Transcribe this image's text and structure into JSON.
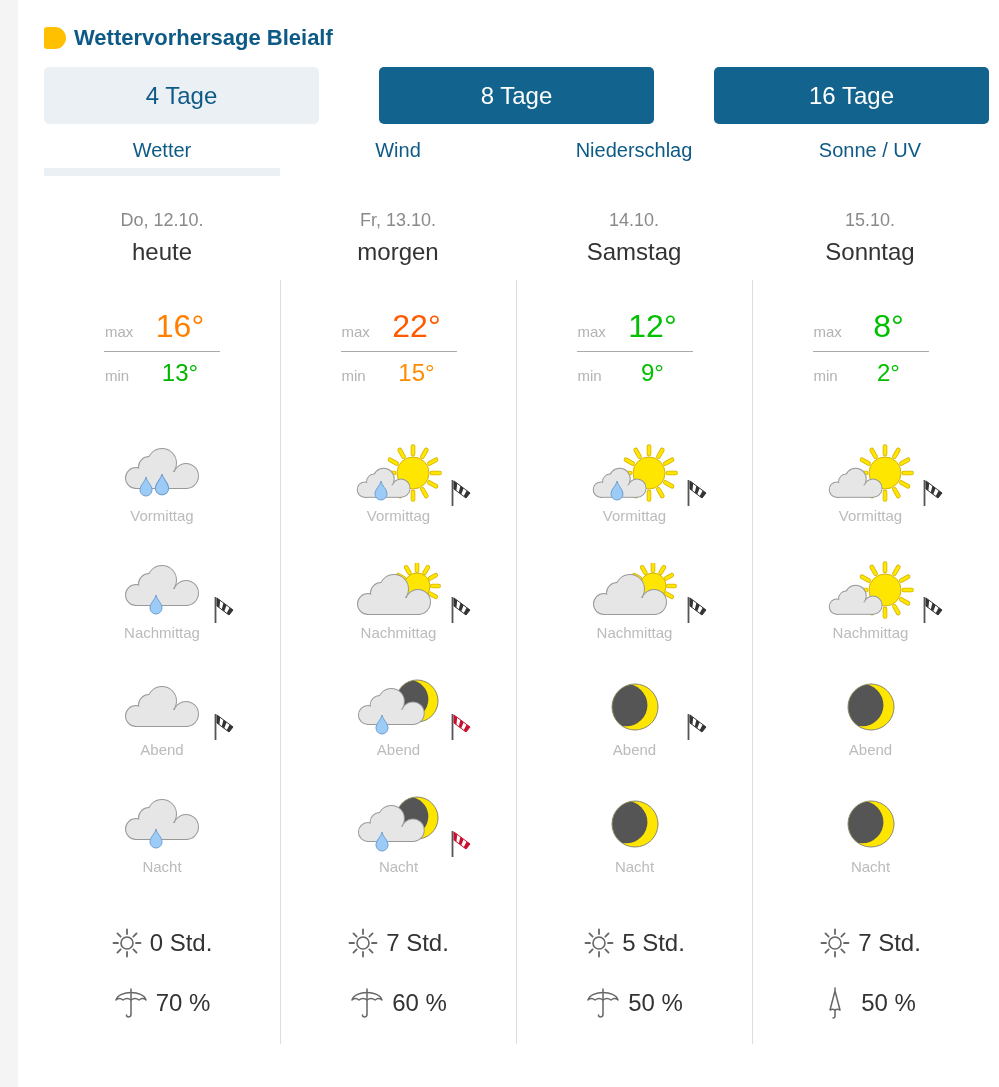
{
  "header": {
    "title": "Wettervorhersage Bleialf"
  },
  "ranges": [
    {
      "label": "4 Tage",
      "selected": true
    },
    {
      "label": "8 Tage",
      "selected": false
    },
    {
      "label": "16 Tage",
      "selected": false
    }
  ],
  "tabs": [
    {
      "label": "Wetter",
      "selected": true
    },
    {
      "label": "Wind",
      "selected": false
    },
    {
      "label": "Niederschlag",
      "selected": false
    },
    {
      "label": "Sonne / UV",
      "selected": false
    }
  ],
  "days": [
    {
      "date": "Do, 12.10.",
      "name": "heute",
      "max": {
        "label": "max",
        "value": "16°",
        "color": "#ff8000"
      },
      "min": {
        "label": "min",
        "value": "13°",
        "color": "#00b400"
      },
      "periods": [
        {
          "label": "Vormittag",
          "kind": "heavy_rain",
          "windsock": false,
          "storm": false
        },
        {
          "label": "Nachmittag",
          "kind": "rain",
          "windsock": true,
          "storm": false
        },
        {
          "label": "Abend",
          "kind": "cloudy",
          "windsock": true,
          "storm": false
        },
        {
          "label": "Nacht",
          "kind": "rain",
          "windsock": false,
          "storm": false
        }
      ],
      "sunshine": "0 Std.",
      "precipitation": {
        "kind": "open",
        "value": "70 %"
      }
    },
    {
      "date": "Fr, 13.10.",
      "name": "morgen",
      "max": {
        "label": "max",
        "value": "22°",
        "color": "#ff5a00"
      },
      "min": {
        "label": "min",
        "value": "15°",
        "color": "#ff8c00"
      },
      "periods": [
        {
          "label": "Vormittag",
          "kind": "sun_shower",
          "windsock": true,
          "storm": false
        },
        {
          "label": "Nachmittag",
          "kind": "partly_cloudy",
          "windsock": true,
          "storm": false
        },
        {
          "label": "Abend",
          "kind": "night_shower",
          "windsock": true,
          "storm": true
        },
        {
          "label": "Nacht",
          "kind": "night_shower",
          "windsock": true,
          "storm": true
        }
      ],
      "sunshine": "7 Std.",
      "precipitation": {
        "kind": "open",
        "value": "60 %"
      }
    },
    {
      "date": "14.10.",
      "name": "Samstag",
      "max": {
        "label": "max",
        "value": "12°",
        "color": "#00c000"
      },
      "min": {
        "label": "min",
        "value": "9°",
        "color": "#00c000"
      },
      "periods": [
        {
          "label": "Vormittag",
          "kind": "sun_shower",
          "windsock": true,
          "storm": false
        },
        {
          "label": "Nachmittag",
          "kind": "partly_cloudy",
          "windsock": true,
          "storm": false
        },
        {
          "label": "Abend",
          "kind": "clear_night",
          "windsock": true,
          "storm": false
        },
        {
          "label": "Nacht",
          "kind": "clear_night",
          "windsock": false,
          "storm": false
        }
      ],
      "sunshine": "5 Std.",
      "precipitation": {
        "kind": "open",
        "value": "50 %"
      }
    },
    {
      "date": "15.10.",
      "name": "Sonntag",
      "max": {
        "label": "max",
        "value": "8°",
        "color": "#00c000"
      },
      "min": {
        "label": "min",
        "value": "2°",
        "color": "#00c000"
      },
      "periods": [
        {
          "label": "Vormittag",
          "kind": "mostly_sunny",
          "windsock": true,
          "storm": false
        },
        {
          "label": "Nachmittag",
          "kind": "mostly_sunny",
          "windsock": true,
          "storm": false
        },
        {
          "label": "Abend",
          "kind": "clear_night",
          "windsock": false,
          "storm": false
        },
        {
          "label": "Nacht",
          "kind": "clear_night",
          "windsock": false,
          "storm": false
        }
      ],
      "sunshine": "7 Std.",
      "precipitation": {
        "kind": "closed",
        "value": "50 %"
      }
    }
  ]
}
